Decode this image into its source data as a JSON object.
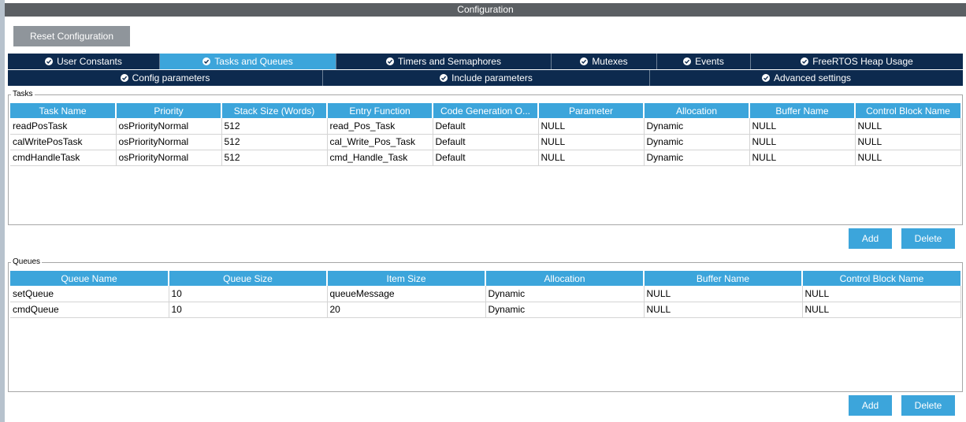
{
  "window": {
    "title": "Configuration"
  },
  "reset_button": "Reset Configuration",
  "tabs_row1": [
    {
      "label": "User Constants",
      "active": false
    },
    {
      "label": "Tasks and Queues",
      "active": true
    },
    {
      "label": "Timers and Semaphores",
      "active": false
    },
    {
      "label": "Mutexes",
      "active": false
    },
    {
      "label": "Events",
      "active": false
    },
    {
      "label": "FreeRTOS Heap Usage",
      "active": false
    }
  ],
  "tabs_row2": [
    {
      "label": "Config parameters"
    },
    {
      "label": "Include parameters"
    },
    {
      "label": "Advanced settings"
    }
  ],
  "tasks": {
    "group_label": "Tasks",
    "columns": [
      "Task Name",
      "Priority",
      "Stack Size (Words)",
      "Entry Function",
      "Code Generation O...",
      "Parameter",
      "Allocation",
      "Buffer Name",
      "Control Block Name"
    ],
    "rows": [
      [
        "readPosTask",
        "osPriorityNormal",
        "512",
        "read_Pos_Task",
        "Default",
        "NULL",
        "Dynamic",
        "NULL",
        "NULL"
      ],
      [
        "calWritePosTask",
        "osPriorityNormal",
        "512",
        "cal_Write_Pos_Task",
        "Default",
        "NULL",
        "Dynamic",
        "NULL",
        "NULL"
      ],
      [
        "cmdHandleTask",
        "osPriorityNormal",
        "512",
        "cmd_Handle_Task",
        "Default",
        "NULL",
        "Dynamic",
        "NULL",
        "NULL"
      ]
    ],
    "add_label": "Add",
    "delete_label": "Delete"
  },
  "queues": {
    "group_label": "Queues",
    "columns": [
      "Queue Name",
      "Queue Size",
      "Item Size",
      "Allocation",
      "Buffer Name",
      "Control Block Name"
    ],
    "rows": [
      [
        "setQueue",
        "10",
        "queueMessage",
        "Dynamic",
        "NULL",
        "NULL"
      ],
      [
        "cmdQueue",
        "10",
        "20",
        "Dynamic",
        "NULL",
        "NULL"
      ]
    ],
    "add_label": "Add",
    "delete_label": "Delete"
  },
  "colors": {
    "accent": "#3ca5db",
    "tab_bar": "#0d2a4e",
    "title_bar": "#5b5f63",
    "reset_button": "#8f959b"
  }
}
